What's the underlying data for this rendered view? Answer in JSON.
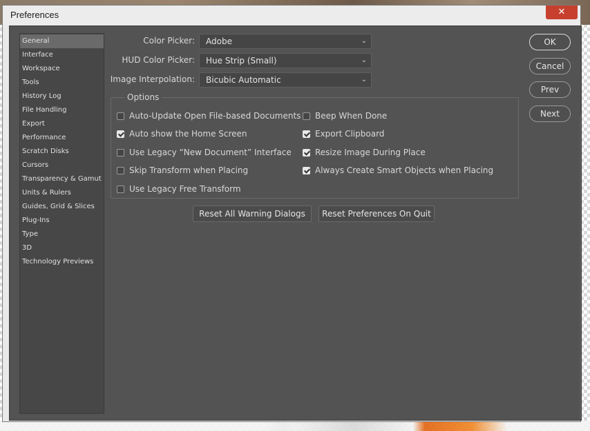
{
  "window": {
    "title": "Preferences",
    "close_glyph": "✕"
  },
  "sidebar": {
    "items": [
      {
        "label": "General",
        "active": true
      },
      {
        "label": "Interface"
      },
      {
        "label": "Workspace"
      },
      {
        "label": "Tools"
      },
      {
        "label": "History Log"
      },
      {
        "label": "File Handling"
      },
      {
        "label": "Export"
      },
      {
        "label": "Performance"
      },
      {
        "label": "Scratch Disks"
      },
      {
        "label": "Cursors"
      },
      {
        "label": "Transparency & Gamut"
      },
      {
        "label": "Units & Rulers"
      },
      {
        "label": "Guides, Grid & Slices"
      },
      {
        "label": "Plug-Ins"
      },
      {
        "label": "Type"
      },
      {
        "label": "3D"
      },
      {
        "label": "Technology Previews"
      }
    ]
  },
  "fields": {
    "color_picker": {
      "label": "Color Picker:",
      "value": "Adobe"
    },
    "hud_color_picker": {
      "label": "HUD Color Picker:",
      "value": "Hue Strip (Small)"
    },
    "image_interpolation": {
      "label": "Image Interpolation:",
      "value": "Bicubic Automatic"
    }
  },
  "options": {
    "title": "Options",
    "left": [
      {
        "label": "Auto-Update Open File-based Documents",
        "checked": false
      },
      {
        "label": "Auto show the Home Screen",
        "checked": true
      },
      {
        "label": "Use Legacy “New Document” Interface",
        "checked": false
      },
      {
        "label": "Skip Transform when Placing",
        "checked": false
      },
      {
        "label": "Use Legacy Free Transform",
        "checked": false
      }
    ],
    "right": [
      {
        "label": "Beep When Done",
        "checked": false
      },
      {
        "label": "Export Clipboard",
        "checked": true
      },
      {
        "label": "Resize Image During Place",
        "checked": true
      },
      {
        "label": "Always Create Smart Objects when Placing",
        "checked": true
      }
    ]
  },
  "buttons": {
    "reset_warnings": "Reset All Warning Dialogs",
    "reset_prefs": "Reset Preferences On Quit",
    "ok": "OK",
    "cancel": "Cancel",
    "prev": "Prev",
    "next": "Next"
  },
  "icons": {
    "dropdown": "chevron-down-icon",
    "checkbox_check": "checkmark-icon"
  }
}
